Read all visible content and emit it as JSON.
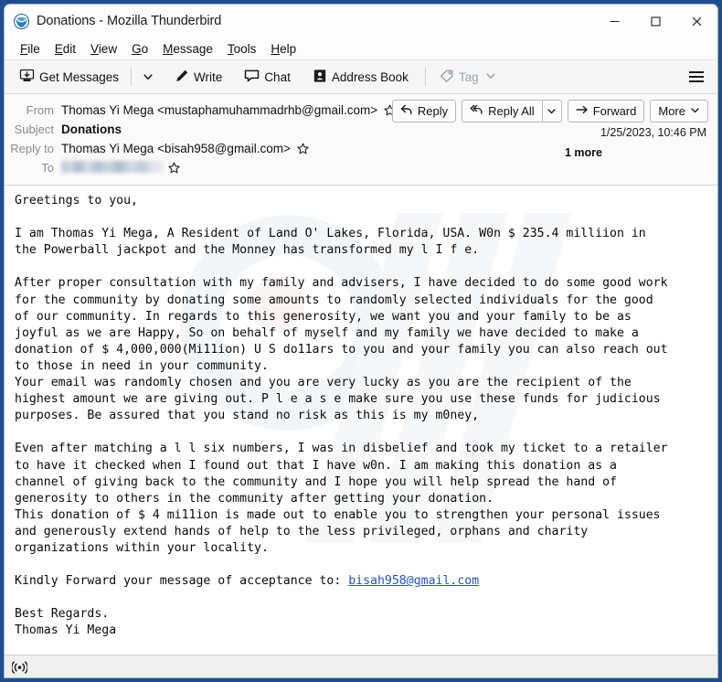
{
  "window": {
    "title": "Donations - Mozilla Thunderbird",
    "app_icon": "thunderbird-icon",
    "minimize_label": "Minimize",
    "maximize_label": "Maximize",
    "close_label": "Close"
  },
  "menubar": {
    "items": [
      {
        "label": "File",
        "accel": "F"
      },
      {
        "label": "Edit",
        "accel": "E"
      },
      {
        "label": "View",
        "accel": "V"
      },
      {
        "label": "Go",
        "accel": "G"
      },
      {
        "label": "Message",
        "accel": "M"
      },
      {
        "label": "Tools",
        "accel": "T"
      },
      {
        "label": "Help",
        "accel": "H"
      }
    ]
  },
  "toolbar": {
    "get_messages": "Get Messages",
    "write": "Write",
    "chat": "Chat",
    "address_book": "Address Book",
    "tag": "Tag",
    "app_menu_label": "Application Menu"
  },
  "message_header": {
    "rows": [
      {
        "label": "From",
        "value": "Thomas Yi Mega <mustaphamuhammadrhb@gmail.com>",
        "star": true,
        "bold": false,
        "redacted": false
      },
      {
        "label": "Subject",
        "value": "Donations",
        "star": false,
        "bold": true,
        "redacted": false
      },
      {
        "label": "Reply to",
        "value": "Thomas Yi Mega <bisah958@gmail.com>",
        "star": true,
        "bold": false,
        "redacted": false
      },
      {
        "label": "To",
        "value": "",
        "star": true,
        "bold": false,
        "redacted": true
      }
    ],
    "actions": {
      "reply": "Reply",
      "reply_all": "Reply All",
      "reply_all_dropdown": "More reply options",
      "forward": "Forward",
      "more": "More"
    },
    "date": "1/25/2023, 10:46 PM",
    "more_recipients": "1 more"
  },
  "body": {
    "part1": "Greetings to you,\n\nI am Thomas Yi Mega, A Resident of Land O' Lakes, Florida, USA. W0n $ 235.4 milliion in\nthe Powerball jackpot and the Monney has transformed my l I f e.\n\nAfter proper consultation with my family and advisers, I have decided to do some good work\nfor the community by donating some amounts to randomly selected individuals for the good\nof our community. In regards to this generosity, we want you and your family to be as\njoyful as we are Happy, So on behalf of myself and my family we have decided to make a\ndonation of $ 4,000,000(Mi11ion) U S do11ars to you and your family you can also reach out\nto those in need in your community.\nYour email was randomly chosen and you are very lucky as you are the recipient of the\nhighest amount we are giving out. P l e a s e make sure you use these funds for judicious\npurposes. Be assured that you stand no risk as this is my m0ney,\n\nEven after matching a l l six numbers, I was in disbelief and took my ticket to a retailer\nto have it checked when I found out that I have w0n. I am making this donation as a\nchannel of giving back to the community and I hope you will help spread the hand of\ngenerosity to others in the community after getting your donation.\nThis donation of $ 4 mi11ion is made out to enable you to strengthen your personal issues\nand generously extend hands of help to the less privileged, orphans and charity\norganizations within your locality.\n\nKindly Forward your message of acceptance to: ",
    "link_text": "bisah958@gmail.com",
    "part2": "\n\nBest Regards.\nThomas Yi Mega\n"
  },
  "statusbar": {
    "icon": "network-activity-icon",
    "text": ""
  },
  "colors": {
    "desktop": "#1f4e8c",
    "toolbar_bg": "#f6f6f6",
    "header_bg": "#fafafa",
    "link": "#2255a8",
    "label_gray": "#8b8b8b"
  }
}
